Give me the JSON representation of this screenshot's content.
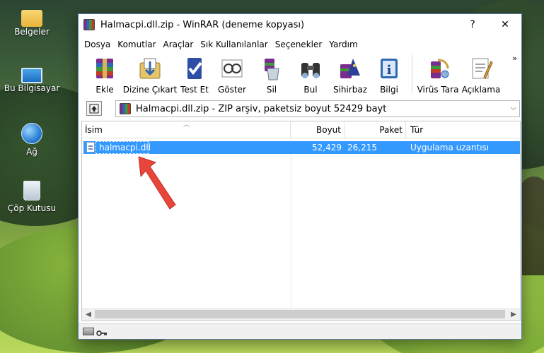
{
  "desktop": {
    "icons": [
      {
        "label": "Belgeler",
        "icon": "folder-icon"
      },
      {
        "label": "Bu Bilgisayar",
        "icon": "computer-icon"
      },
      {
        "label": "Ağ",
        "icon": "network-icon"
      },
      {
        "label": "Çöp Kutusu",
        "icon": "recycle-bin-icon"
      }
    ]
  },
  "window": {
    "title": "Halmacpi.dll.zip - WinRAR (deneme kopyası)",
    "help_glyph": "?",
    "close_glyph": "✕",
    "menu": [
      "Dosya",
      "Komutlar",
      "Araçlar",
      "Sık Kullanılanlar",
      "Seçenekler",
      "Yardım"
    ],
    "toolbar": [
      {
        "label": "Ekle",
        "icon": "add-archive-icon"
      },
      {
        "label": "Dizine Çıkart",
        "icon": "extract-to-icon"
      },
      {
        "label": "Test Et",
        "icon": "test-icon"
      },
      {
        "label": "Göster",
        "icon": "view-icon"
      },
      {
        "label": "Sil",
        "icon": "delete-icon"
      },
      {
        "label": "Bul",
        "icon": "find-icon"
      },
      {
        "label": "Sihirbaz",
        "icon": "wizard-icon"
      },
      {
        "label": "Bilgi",
        "icon": "info-icon"
      },
      {
        "label": "Virüs Tara",
        "icon": "virus-scan-icon"
      },
      {
        "label": "Açıklama",
        "icon": "comment-icon"
      }
    ],
    "toolbar_more_glyph": "»",
    "address": {
      "text": "Halmacpi.dll.zip - ZIP arşiv, paketsiz boyut 52429 bayt",
      "dropdown_glyph": "⌵"
    },
    "columns": {
      "name": "İsim",
      "size": "Boyut",
      "packed": "Paket",
      "type": "Tür"
    },
    "files": [
      {
        "name": "halmacpi.dll",
        "size": "52,429",
        "packed": "26,215",
        "type": "Uygulama uzantısı",
        "selected": true
      }
    ],
    "scroll": {
      "left_glyph": "◀",
      "right_glyph": "▶"
    }
  },
  "colors": {
    "selection": "#3399ff",
    "annotation_arrow": "#e8463a"
  }
}
